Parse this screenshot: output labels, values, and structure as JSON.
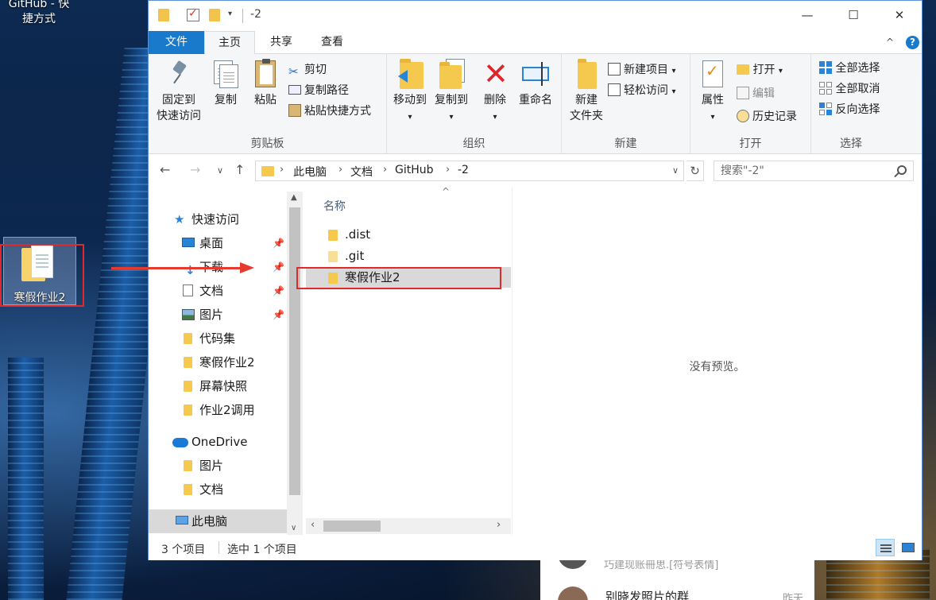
{
  "desktop": {
    "shortcut_top_text": "GitHub - 快\n捷方式",
    "desktop_icon_label": "寒假作业2"
  },
  "chat": {
    "preview_line": "巧建现账冊思.[符号表情]",
    "contact_name": "别晓发照片的群",
    "time": "昨天"
  },
  "window": {
    "title": "-2",
    "controls": {
      "minimize": "—",
      "maximize": "☐",
      "close": "✕"
    }
  },
  "ribbon_tabs": [
    "文件",
    "主页",
    "共享",
    "查看"
  ],
  "ribbon": {
    "clipboard": {
      "label": "剪贴板",
      "pin_label_line1": "固定到",
      "pin_label_line2": "快速访问",
      "copy": "复制",
      "paste": "粘贴",
      "cut": "剪切",
      "copy_path": "复制路径",
      "paste_shortcut": "粘贴快捷方式"
    },
    "organize": {
      "label": "组织",
      "move_to": "移动到",
      "copy_to": "复制到",
      "delete": "删除",
      "rename": "重命名"
    },
    "new": {
      "label": "新建",
      "new_folder_line1": "新建",
      "new_folder_line2": "文件夹",
      "new_item": "新建项目",
      "easy_access": "轻松访问"
    },
    "open": {
      "label": "打开",
      "properties": "属性",
      "open": "打开",
      "edit": "编辑",
      "history": "历史记录"
    },
    "select": {
      "label": "选择",
      "select_all": "全部选择",
      "select_none": "全部取消",
      "invert": "反向选择"
    }
  },
  "address": {
    "segments": [
      "此电脑",
      "文档",
      "GitHub",
      "-2"
    ],
    "search_placeholder": "搜索\"-2\""
  },
  "nav_pane": {
    "quick_access": "快速访问",
    "items": [
      "桌面",
      "下载",
      "文档",
      "图片",
      "代码集",
      "寒假作业2",
      "屏幕快照",
      "作业2调用"
    ],
    "onedrive": "OneDrive",
    "onedrive_items": [
      "图片",
      "文档"
    ],
    "this_pc": "此电脑"
  },
  "file_list": {
    "column_name": "名称",
    "files": [
      ".dist",
      ".git",
      "寒假作业2"
    ]
  },
  "preview": {
    "text": "没有预览。"
  },
  "status": {
    "item_count": "3 个项目",
    "selected": "选中 1 个项目"
  },
  "colors": {
    "accent": "#1979ca",
    "annotation_red": "#e02a2a",
    "folder": "#f5c94d",
    "selection": "#d9d9d9"
  }
}
